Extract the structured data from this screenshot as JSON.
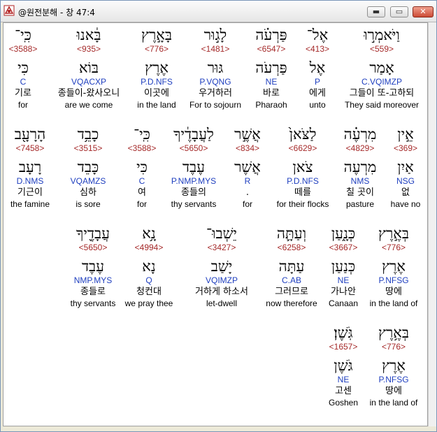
{
  "window": {
    "title": "@원전분해 - 창 47:4",
    "minimize_glyph": "▬",
    "maximize_glyph": "▭",
    "close_glyph": "✕"
  },
  "rows": [
    {
      "words": [
        {
          "heb1": "כִּֽי־",
          "code": "<3588>",
          "heb2": "כִּי",
          "morph": "C",
          "kor": "기로",
          "eng": "for"
        },
        {
          "heb1": "בָּ֔אנוּ",
          "code": "<935>",
          "heb2": "בּוֹא",
          "morph": "VQACXP",
          "kor": "종들이-왔사오니",
          "eng": "are we come"
        },
        {
          "heb1": "בָּאָ֣רֶץ",
          "code": "<776>",
          "heb2": "אֶרֶץ",
          "morph": "P.D.NFS",
          "kor": "이곳에",
          "eng": "in the land"
        },
        {
          "heb1": "לָג֣וּר",
          "code": "<1481>",
          "heb2": "גּוּר",
          "morph": "P.VQNG",
          "kor": "우거하러",
          "eng": "For to sojourn"
        },
        {
          "heb1": "פַּרְעֹ֗ה",
          "code": "<6547>",
          "heb2": "פַּרְעֹה",
          "morph": "NE",
          "kor": "바로",
          "eng": "Pharaoh"
        },
        {
          "heb1": "אֶל־",
          "code": "<413>",
          "heb2": "אֶל",
          "morph": "P",
          "kor": "에게",
          "eng": "unto"
        },
        {
          "heb1": "וַיֹּאמְר֣וּ",
          "code": "<559>",
          "heb2": "אָמַר",
          "morph": "C.VQIMZP",
          "kor": "그들이 또-고하되",
          "eng": "They said moreover"
        }
      ]
    },
    {
      "words": [
        {
          "heb1": "הָרָעָ֖ב",
          "code": "<7458>",
          "heb2": "רָעָב",
          "morph": "D.NMS",
          "kor": "기근이",
          "eng": "the famine"
        },
        {
          "heb1": "כָבֵ֥ד",
          "code": "<3515>",
          "heb2": "כָּבֵד",
          "morph": "VQAMZS",
          "kor": "심하",
          "eng": "is sore"
        },
        {
          "heb1": "כִּֽי־",
          "code": "<3588>",
          "heb2": "כִּי",
          "morph": "C",
          "kor": "여",
          "eng": "for"
        },
        {
          "heb1": "לַעֲבָדֶ֔יךָ",
          "code": "<5650>",
          "heb2": "עֶבֶד",
          "morph": "P.NMP.MYS",
          "kor": "종들의",
          "eng": "thy servants"
        },
        {
          "heb1": "אֲשֶׁ֣ר",
          "code": "<834>",
          "heb2": "אֲשֶׁר",
          "morph": "R",
          "kor": ".",
          "eng": "for"
        },
        {
          "heb1": "לַצֹּאן֙",
          "code": "<6629>",
          "heb2": "צֹאן",
          "morph": "P.D.NFS",
          "kor": "떼를",
          "eng": "for their flocks"
        },
        {
          "heb1": "מִרְעֶ֗ה",
          "code": "<4829>",
          "heb2": "מִרְעֶה",
          "morph": "NMS",
          "kor": "칠 곳이",
          "eng": "pasture"
        },
        {
          "heb1": "אֵ֣ין",
          "code": "<369>",
          "heb2": "אַיִן",
          "morph": "NSG",
          "kor": "없",
          "eng": "have no"
        }
      ]
    },
    {
      "words": [
        {
          "heb1": "עֲבָדֶ֖יךָ",
          "code": "<5650>",
          "heb2": "עֶבֶד",
          "morph": "NMP.MYS",
          "kor": "종들로",
          "eng": "thy servants"
        },
        {
          "heb1": "נָ֥א",
          "code": "<4994>",
          "heb2": "נָא",
          "morph": "Q",
          "kor": "청컨대",
          "eng": "we pray thee"
        },
        {
          "heb1": "יֵשְׁבוּ־",
          "code": "<3427>",
          "heb2": "יָשַׁב",
          "morph": "VQIMZP",
          "kor": "거하게 하소서",
          "eng": "let-dwell"
        },
        {
          "heb1": "וְעַתָּ֛ה",
          "code": "<6258>",
          "heb2": "עַתָּה",
          "morph": "C.AB",
          "kor": "그러므로",
          "eng": "now therefore"
        },
        {
          "heb1": "כְּנָ֑עַן",
          "code": "<3667>",
          "heb2": "כְּנַעַן",
          "morph": "NE",
          "kor": "가나안",
          "eng": "Canaan"
        },
        {
          "heb1": "בְּאֶ֣רֶץ",
          "code": "<776>",
          "heb2": "אֶרֶץ",
          "morph": "P.NFSG",
          "kor": "땅에",
          "eng": "in the land of"
        }
      ]
    },
    {
      "words": [
        {
          "heb1": "גֹּֽשֶׁן׃",
          "code": "<1657>",
          "heb2": "גֹּשֶׁן",
          "morph": "NE",
          "kor": "고센",
          "eng": "Goshen"
        },
        {
          "heb1": "בְּאֶ֥רֶץ",
          "code": "<776>",
          "heb2": "אֶרֶץ",
          "morph": "P.NFSG",
          "kor": "땅에",
          "eng": "in the land of"
        }
      ]
    }
  ]
}
